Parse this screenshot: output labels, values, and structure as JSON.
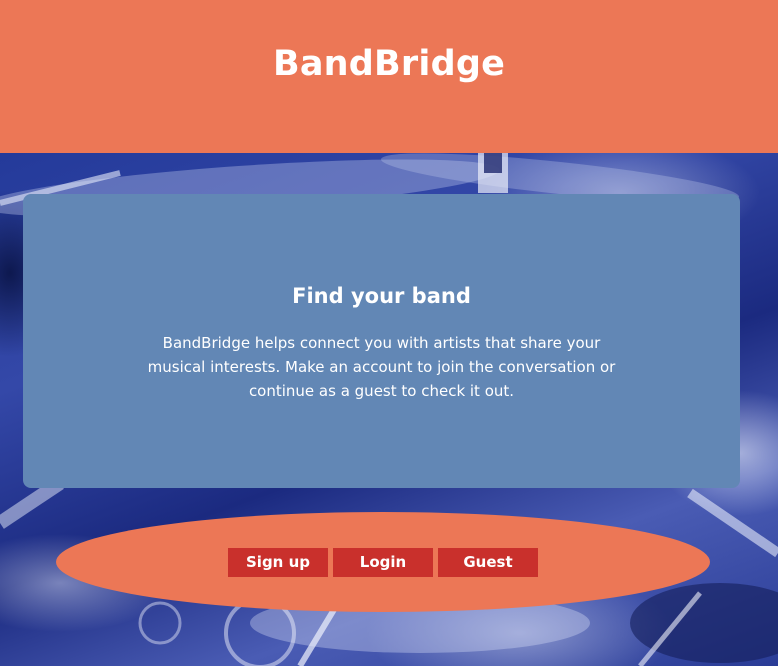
{
  "header": {
    "title": "BandBridge"
  },
  "card": {
    "heading": "Find your band",
    "body": "BandBridge helps connect you with artists that share your musical interests. Make an account to join the conversation or continue as a guest to check it out."
  },
  "actions": {
    "signup_label": "Sign up",
    "login_label": "Login",
    "guest_label": "Guest"
  },
  "colors": {
    "header_bg": "#ec7756",
    "card_bg": "#6287b5",
    "button_bg": "#c9302c",
    "hero_tint": "#243a9a"
  },
  "background_image": "drum-kit-photo"
}
